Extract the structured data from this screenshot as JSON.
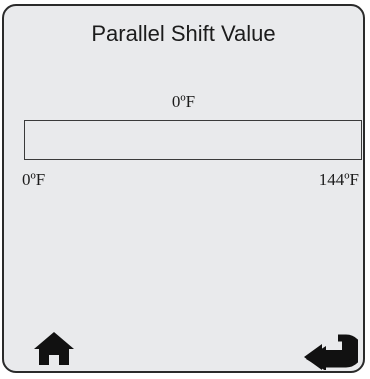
{
  "screen": {
    "title": "Parallel Shift Value",
    "current_value": "0ºF",
    "range_min": "0ºF",
    "range_max": "144ºF",
    "progress_fraction": 0
  },
  "icons": {
    "home": "home-icon",
    "back": "return-arrow-icon"
  },
  "colors": {
    "background": "#e9eaec",
    "foreground": "#1c1c1c",
    "bar_border": "#3a3a3a"
  }
}
